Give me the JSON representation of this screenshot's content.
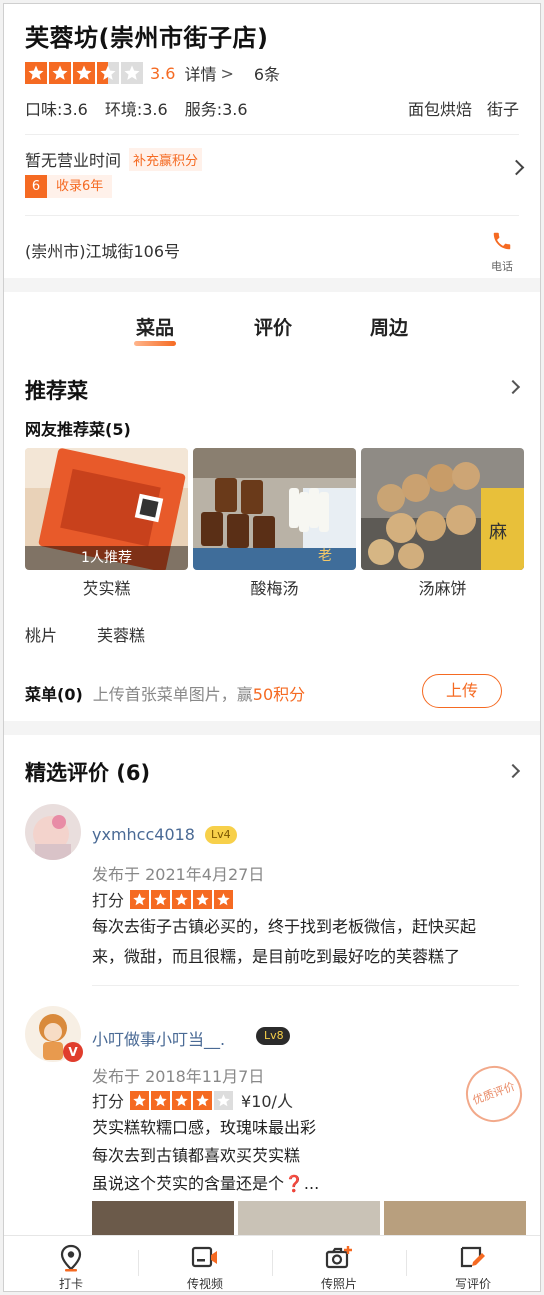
{
  "shop": {
    "name": "芙蓉坊(崇州市街子店)",
    "rating": 3.6,
    "rating_text": "3.6",
    "detail_link": "详情",
    "review_count": "6条",
    "taste": "口味:3.6",
    "environment": "环境:3.6",
    "service": "服务:3.6",
    "tags": [
      "面包烘焙",
      "街子"
    ],
    "hours": "暂无营业时间",
    "supplement": "补充赢积分",
    "badge_number": "6",
    "badge_text": "收录6年",
    "address": "(崇州市)江城街106号",
    "phone_label": "电话"
  },
  "tabs": [
    "菜品",
    "评价",
    "周边"
  ],
  "recommended": {
    "title": "推荐菜",
    "subtitle": "网友推荐菜(5)",
    "dishes": [
      {
        "name": "芡实糕",
        "tag": "1人推荐"
      },
      {
        "name": "酸梅汤"
      },
      {
        "name": "汤麻饼"
      }
    ],
    "extra_dishes": [
      "桃片",
      "芙蓉糕"
    ],
    "menu_label": "菜单(0)",
    "menu_hint_prefix": "上传首张菜单图片，赢",
    "menu_hint_points": "50积分",
    "upload_label": "上传"
  },
  "reviews": {
    "title": "精选评价 (6)",
    "items": [
      {
        "user": "yxmhcc4018",
        "level": "Lv4",
        "date": "发布于 2021年4月27日",
        "score_label": "打分",
        "stars": 5,
        "lines": [
          "每次去街子古镇必买的，终于找到老板微信，赶快买起",
          "来，微甜，而且很糯，是目前吃到最好吃的芙蓉糕了"
        ]
      },
      {
        "user": "小叮做事小叮当__.",
        "level": "Lv8",
        "date": "发布于 2018年11月7日",
        "score_label": "打分",
        "stars": 4,
        "price": "¥10/人",
        "lines": [
          "芡实糕软糯口感，玫瑰味最出彩",
          "每次去到古镇都喜欢买芡实糕",
          "虽说这个芡实的含量还是个❓..."
        ],
        "stamp": "优质评价"
      }
    ]
  },
  "bottom_bar": [
    "打卡",
    "传视频",
    "传照片",
    "写评价"
  ],
  "colors": {
    "accent": "#f56a22",
    "username": "#4a6a95"
  }
}
